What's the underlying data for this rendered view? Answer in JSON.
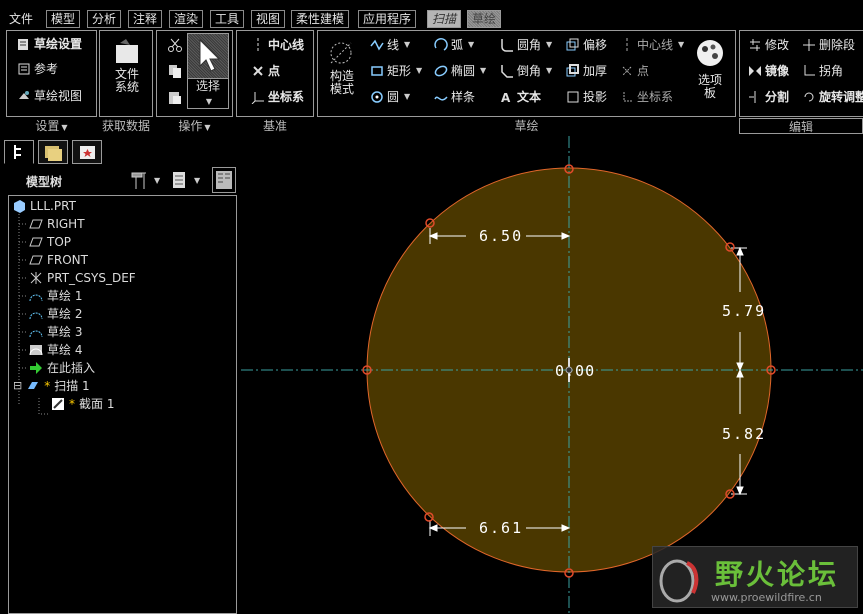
{
  "menubar": {
    "items": [
      "文件",
      "模型",
      "分析",
      "注释",
      "渲染",
      "工具",
      "视图",
      "柔性建模",
      "应用程序",
      "扫描",
      "草绘"
    ]
  },
  "ribbon": {
    "groups": {
      "setup": {
        "label": "设置",
        "items": [
          "草绘设置",
          "参考",
          "草绘视图"
        ]
      },
      "getdata": {
        "label": "获取数据",
        "file_system": [
          "文件",
          "系统"
        ]
      },
      "operations": {
        "label": "操作",
        "select": "选择"
      },
      "datum": {
        "label": "基准",
        "items": [
          "中心线",
          "点",
          "坐标系"
        ]
      },
      "sketch": {
        "label": "草绘",
        "construct": [
          "构造",
          "模式"
        ],
        "col1": [
          "线",
          "矩形",
          "圆"
        ],
        "col2": [
          "弧",
          "椭圆",
          "样条"
        ],
        "col3": [
          "圆角",
          "倒角",
          "文本"
        ],
        "col4": [
          "偏移",
          "加厚",
          "投影"
        ],
        "col5": [
          "中心线",
          "点",
          "坐标系"
        ],
        "palette": [
          "选项",
          "板"
        ]
      },
      "edit": {
        "label": "编辑",
        "items": [
          "修改",
          "删除段",
          "镜像",
          "拐角",
          "分割",
          "旋转调整"
        ]
      }
    }
  },
  "model_tree": {
    "title": "模型树",
    "items": [
      {
        "label": "LLL.PRT",
        "icon": "part-icon"
      },
      {
        "label": "RIGHT",
        "icon": "datum-plane-icon"
      },
      {
        "label": "TOP",
        "icon": "datum-plane-icon"
      },
      {
        "label": "FRONT",
        "icon": "datum-plane-icon"
      },
      {
        "label": "PRT_CSYS_DEF",
        "icon": "csys-icon"
      },
      {
        "label": "草绘 1",
        "icon": "sketch-icon"
      },
      {
        "label": "草绘 2",
        "icon": "sketch-icon"
      },
      {
        "label": "草绘 3",
        "icon": "sketch-icon"
      },
      {
        "label": "草绘 4",
        "icon": "sketch-icon"
      },
      {
        "label": "在此插入",
        "icon": "insert-arrow-icon"
      },
      {
        "label": "扫描 1",
        "icon": "sweep-icon",
        "prefix": "*",
        "expander": "⊟"
      },
      {
        "label": "截面 1",
        "icon": "section-icon",
        "prefix": "*"
      }
    ]
  },
  "sketch": {
    "dimensions": {
      "top": "6.50",
      "right_upper": "5.79",
      "right_lower": "5.82",
      "bottom": "6.61",
      "center": "0.00"
    },
    "colors": {
      "fill": "#4a3700",
      "outline": "#e0662a",
      "centerline": "#3aa0a0",
      "dimension": "#ffffff",
      "vertex": "#e04a2a"
    }
  },
  "watermark": {
    "title": "野火论坛",
    "url": "www.proewildfire.cn"
  },
  "colors": {
    "menu_text": "#e4e4e4",
    "border": "#9a9a9a",
    "background": "#000000"
  }
}
